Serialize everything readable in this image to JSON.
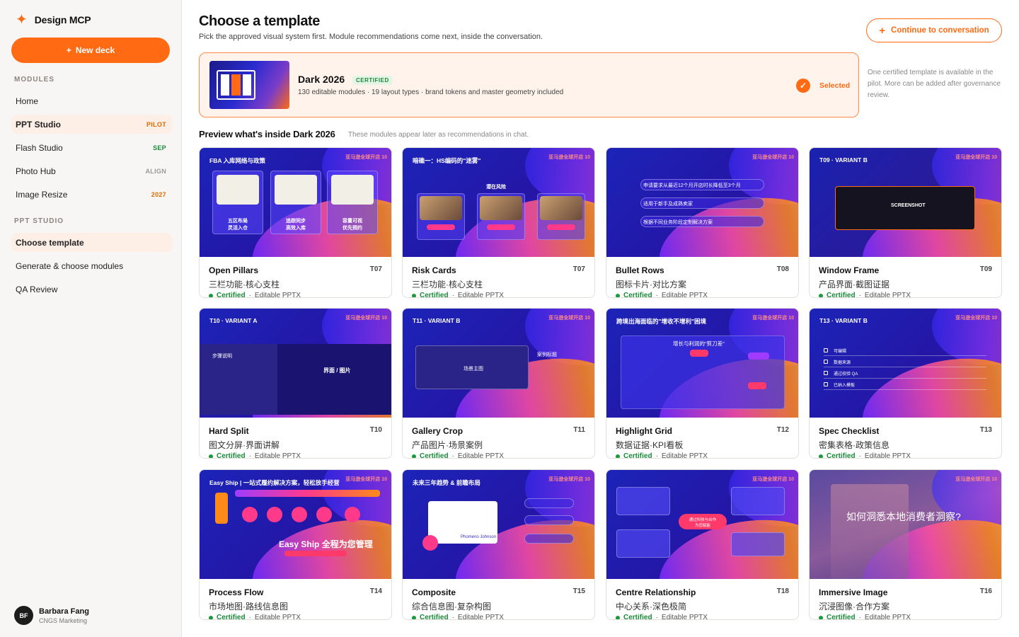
{
  "app": {
    "name": "Design MCP",
    "new_deck": "New deck"
  },
  "sidebar": {
    "modules_label": "MODULES",
    "modules": [
      {
        "label": "Home",
        "badge": ""
      },
      {
        "label": "PPT Studio",
        "badge": "PILOT",
        "badge_color": "#e26a00"
      },
      {
        "label": "Flash Studio",
        "badge": "SEP",
        "badge_color": "#1a8a3a"
      },
      {
        "label": "Photo Hub",
        "badge": "ALIGN",
        "badge_color": "#999999"
      },
      {
        "label": "Image Resize",
        "badge": "2027",
        "badge_color": "#e26a00"
      }
    ],
    "studio_label": "PPT STUDIO",
    "studio_items": [
      {
        "label": "Choose template"
      },
      {
        "label": "Generate & choose modules"
      },
      {
        "label": "QA Review"
      }
    ]
  },
  "user": {
    "initials": "BF",
    "name": "Barbara Fang",
    "org": "CNGS Marketing"
  },
  "main": {
    "title": "Choose a template",
    "subtitle": "Pick the approved visual system first. Module recommendations come next, inside the conversation.",
    "continue_label": "Continue to conversation"
  },
  "selected": {
    "name": "Dark 2026",
    "badge": "CERTIFIED",
    "description": "130 editable modules · 19 layout types · brand tokens and master geometry included",
    "status": "Selected"
  },
  "side_note": "One certified template is available in the pilot. More can be added after governance review.",
  "preview": {
    "title": "Preview what's inside Dark 2026",
    "subtitle": "These modules appear later as recommendations in chat."
  },
  "card_meta": {
    "certified": "Certified",
    "separator": "·",
    "editable": "Editable PPTX"
  },
  "cards": [
    {
      "name": "Open Pillars",
      "code": "T07",
      "desc": "三栏功能·核心支柱",
      "headline": "FBA 入库网络与政策",
      "labels": [
        "五区布局\n灵活入仓",
        "追踪同步\n高效入库",
        "容量可视\n优先预约"
      ]
    },
    {
      "name": "Risk Cards",
      "code": "T07",
      "desc": "三栏功能·核心支柱",
      "headline": "暗礁一：HS编码的\"迷雾\"",
      "labels": [
        "潜在风险"
      ]
    },
    {
      "name": "Bullet Rows",
      "code": "T08",
      "desc": "图标卡片·对比方案",
      "headline": "",
      "labels": [
        "申请要求从最近12个月开店时长降低至3个月",
        "适用于新手及成熟卖家",
        "根据不同业务阶段定制解决方案"
      ]
    },
    {
      "name": "Window Frame",
      "code": "T09",
      "desc": "产品界面·截图证据",
      "headline": "T09 · VARIANT B",
      "labels": [
        "SCREENSHOT"
      ]
    },
    {
      "name": "Hard Split",
      "code": "T10",
      "desc": "图文分屏·界面讲解",
      "headline": "T10 · VARIANT A",
      "labels": [
        "步骤说明",
        "界面 / 图片"
      ]
    },
    {
      "name": "Gallery Crop",
      "code": "T11",
      "desc": "产品图片·场景案例",
      "headline": "T11 · VARIANT B",
      "labels": [
        "场景主图",
        "案例标题"
      ]
    },
    {
      "name": "Highlight Grid",
      "code": "T12",
      "desc": "数据证据·KPI看板",
      "headline": "跨境出海面临的\"增收不增利\"困境",
      "labels": [
        "增长与利润的\"剪刀差\""
      ]
    },
    {
      "name": "Spec Checklist",
      "code": "T13",
      "desc": "密集表格·政策信息",
      "headline": "T13 · VARIANT B",
      "labels": [
        "可编辑",
        "数据来源",
        "通过校验 QA",
        "已纳入模板"
      ]
    },
    {
      "name": "Process Flow",
      "code": "T14",
      "desc": "市场地图·路线信息图",
      "headline": "Easy Ship | 一站式履约解决方案，轻松放手经营",
      "labels": [
        "Easy Ship 全程为您管理"
      ]
    },
    {
      "name": "Composite",
      "code": "T15",
      "desc": "综合信息图·复杂构图",
      "headline": "未来三年趋势 & 前瞻布局",
      "labels": [
        "Phomeno Johnson"
      ]
    },
    {
      "name": "Centre Relationship",
      "code": "T18",
      "desc": "中心关系·深色极简",
      "headline": "",
      "labels": [
        "通过科技与合作\n为您赋能"
      ]
    },
    {
      "name": "Immersive Image",
      "code": "T16",
      "desc": "沉浸图像·合作方案",
      "headline": "",
      "labels": [
        "如何洞悉本地消费者洞察?"
      ]
    }
  ]
}
